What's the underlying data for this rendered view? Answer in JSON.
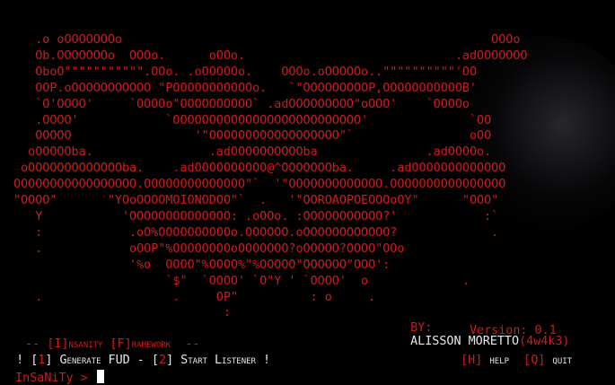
{
  "terminal": {
    "ascii_art": "    .o oOOOOOOOo                                                   OOOo\n    Ob.OOOOOOOo  OOOo.      oOOo.                             .adOOOOOOO\n    OboO\"\"\"\"\"\"\"\"\"\"\".OOo. .oOOOOOo.    OOOo.oOOOOOo..\"\"\"\"\"\"\"\"\"\"'OO\n    OOP.oOOOOOOOOOOO \"POOOOOOOOOOOo.   `\"OOOOOOOOOP,OOOOOOOOOOOB'\n    `O'OOOO'     `OOOOo\"OOOOOOOOOO` .adOOOOOOOOO\"oOOO'    `OOOOo\n    .OOOO'            `OOOOOOOOOOOOOOOOOOOOOOOOOO'              `OO\n    OOOOO                 '\"OOOOOOOOOOOOOOOOOO\"`                oOO\n   oOOOOOba.                .adOOOOOOOOOOba               .adOOOOo.\n  oOOOOOOOOOOOOOba.    .adOOOOOOOOOO@^OOOOOOOba.     .adOOOOOOOOOOOOO\n OOOOOOOOOOOOOOOOO.OOOOOOOOOOOOOO\"`  '\"OOOOOOOOOOOOO.OOOOOOOOOOOOOOOO\n \"OOOO\"       \"YOoOOOOMOIONODOO\"`  .   '\"OOROAOPOEOOOoOY\"      \"OOO\"\n    Y           'OOOOOOOOOOOOOO: .oOOo. :OOOOOOOOOOO?'            :`\n    :            .oO%OOOOOOOOOOo.OOOOOO.oOOOOOOOOOOOO?             .\n    .            oOOP\"%OOOOOOOOoOOOOOOO?oOOOOO?OOOO\"OOo\n                 '%o  OOOO\"%OOOO%\"%OOOOO\"OOOOOO\"OOO':\n                      `$\"  `OOOO' `O\"Y ' `OOOO'  o             .\n    .                  .     OP\"          : o     .\n                              :",
    "author_prefix": "BY:",
    "author_name": "ALISSON MORETTO",
    "author_handle": "(4w4k3)",
    "framework_line": " -- [I]nsanity [F]ramework  --",
    "version": "Version: 0.1",
    "menu_open": "! [",
    "menu_key_1": "1",
    "menu_label_1": "] Generate FUD - [",
    "menu_key_2": "2",
    "menu_label_2": "] Start Listener !",
    "help_bracket": "[H]",
    "help_label": " help  ",
    "quit_bracket": "[Q]",
    "quit_label": " quit",
    "prompt": "InSaNiTy > "
  },
  "colors": {
    "accent": "#d11a1a",
    "text": "#e8e8e8",
    "background": "#000000"
  }
}
